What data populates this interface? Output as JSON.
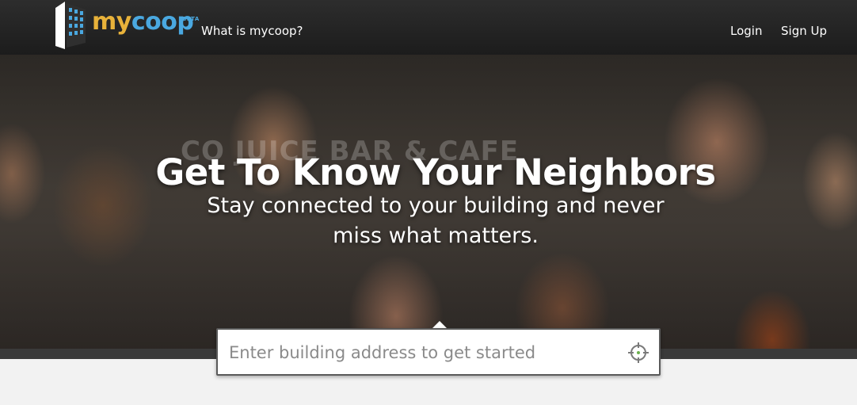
{
  "header": {
    "logo": {
      "word_my": "my",
      "word_coop": "coop",
      "badge": "BETA",
      "icon": "building-icon"
    },
    "nav": {
      "what_is": "What is mycoop?",
      "login": "Login",
      "signup": "Sign Up"
    }
  },
  "hero": {
    "signage": "CO JUICE BAR & CAFE",
    "title": "Get To Know Your Neighbors",
    "subtitle": "Stay connected to your building and never miss what matters."
  },
  "search": {
    "placeholder": "Enter building address to get started",
    "value": "",
    "icon": "crosshair-locate-icon"
  },
  "colors": {
    "logo_my": "#e8b23a",
    "logo_coop": "#4aa8e0",
    "header_bg": "#242424",
    "page_bg": "#f2f2f2"
  }
}
